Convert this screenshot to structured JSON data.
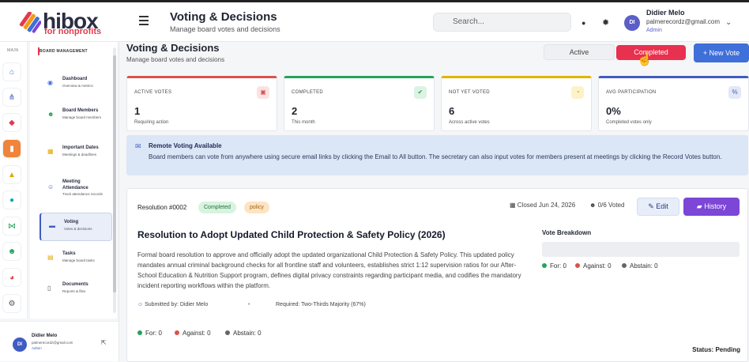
{
  "app": {
    "logo_text": "hibox",
    "logo_sub": "for nonprofits"
  },
  "header": {
    "title": "Voting & Decisions",
    "subtitle": "Manage board votes and decisions",
    "search_placeholder": "Search...",
    "user": {
      "initials": "DI",
      "name": "Didier Melo",
      "email": "palmerecordz@gmail.com",
      "role": "Admin"
    }
  },
  "rail": {
    "label": "MAIN"
  },
  "submenu": {
    "header": "BOARD MANAGEMENT",
    "items": [
      {
        "title": "Dashboard",
        "desc": "Overview & metrics"
      },
      {
        "title": "Board Members",
        "desc": "Manage board members"
      },
      {
        "title": "Important Dates",
        "desc": "Meetings & deadlines"
      },
      {
        "title": "Meeting Attendance",
        "desc": "Track attendance records"
      },
      {
        "title": "Voting",
        "desc": "Votes & decisions"
      },
      {
        "title": "Tasks",
        "desc": "Manage board tasks"
      },
      {
        "title": "Documents",
        "desc": "Reports & files"
      }
    ]
  },
  "sidebar_footer": {
    "initials": "DI",
    "name": "Didier Melo",
    "email": "palmerecordz@gmail.com",
    "role": "Admin"
  },
  "main": {
    "title": "Voting & Decisions",
    "subtitle": "Manage board votes and decisions",
    "filters": {
      "active": "Active",
      "completed": "Completed"
    },
    "new_vote": "+ New Vote"
  },
  "stats": [
    {
      "label": "ACTIVE VOTES",
      "value": "1",
      "desc": "Requiring action",
      "color": "#d9534f"
    },
    {
      "label": "COMPLETED",
      "value": "2",
      "desc": "This month",
      "color": "#23a35a"
    },
    {
      "label": "NOT YET VOTED",
      "value": "6",
      "desc": "Across active votes",
      "color": "#e0b400"
    },
    {
      "label": "AVG PARTICIPATION",
      "value": "0%",
      "desc": "Completed votes only",
      "color": "#3f5cc0"
    }
  ],
  "notice": {
    "title": "Remote Voting Available",
    "text": "Board members can vote from anywhere using secure email links by clicking the Email to All button. The secretary can also input votes for members present at meetings by clicking the Record Votes button."
  },
  "resolution": {
    "number": "Resolution #0002",
    "status_badge": "Completed",
    "category_badge": "policy",
    "closed": "Closed Jun 24, 2026",
    "voted": "0/6 Voted",
    "edit": "Edit",
    "history": "History",
    "title": "Resolution to Adopt Updated Child Protection & Safety Policy (2026)",
    "body": "Formal board resolution to approve and officially adopt the updated organizational Child Protection & Safety Policy. This updated policy mandates annual criminal background checks for all frontline staff and volunteers, establishes strict 1:12 supervision ratios for our After-School Education & Nutrition Support program, defines digital privacy constraints regarding participant media, and codifies the mandatory incident reporting workflows within the platform.",
    "submitted_by": "Submitted by: Didier Melo",
    "required": "Required: Two-Thirds Majority (67%)",
    "breakdown_title": "Vote Breakdown",
    "for": "For: 0",
    "against": "Against: 0",
    "abstain": "Abstain: 0",
    "status": "Status: Pending"
  },
  "colors": {
    "for": "#23a35a",
    "against": "#d9534f",
    "abstain": "#666666"
  }
}
